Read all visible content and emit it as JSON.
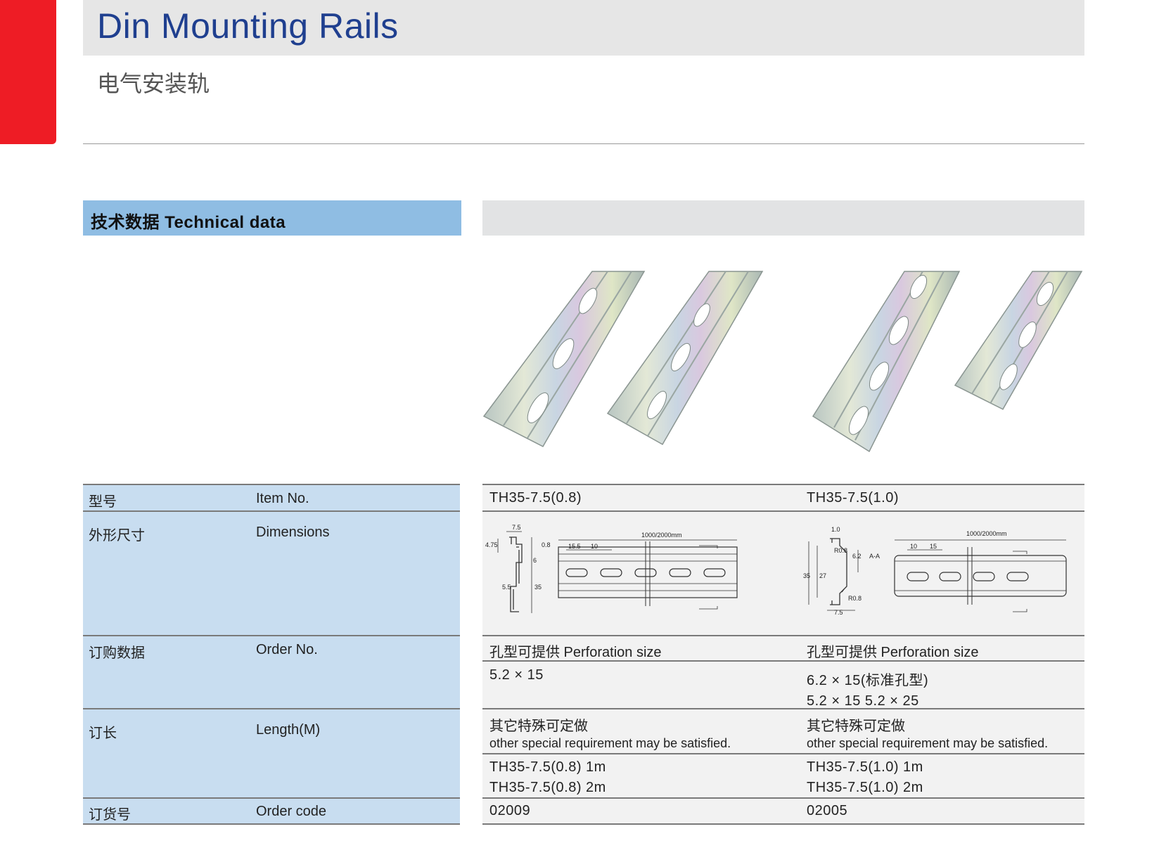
{
  "header": {
    "title": "Din Mounting Rails",
    "subtitle": "电气安装轨"
  },
  "section": {
    "title": "技术数据 Technical data"
  },
  "rows": [
    {
      "label_cn": "型号",
      "label_en": "Item No."
    },
    {
      "label_cn": "外形尺寸",
      "label_en": "Dimensions"
    },
    {
      "label_cn": "订购数据",
      "label_en": "Order No."
    },
    {
      "label_cn": "订长",
      "label_en": "Length(M)"
    },
    {
      "label_cn": "订货号",
      "label_en": "Order code"
    }
  ],
  "products": [
    {
      "item_no": "TH35-7.5(0.8)",
      "perforation_label": "孔型可提供  Perforation size",
      "perforation_line1": "5.2 × 15",
      "perforation_line2": "",
      "special_cn": "其它特殊可定做",
      "special_en": "other special requirement may be satisfied.",
      "length_line1": "TH35-7.5(0.8)  1m",
      "length_line2": "TH35-7.5(0.8)  2m",
      "order_code": "02009",
      "drawing": {
        "d_top": "7.5",
        "d_left": "4.75",
        "d_thick": "0.8",
        "d_6": "6",
        "d_55": "5.5",
        "d_35": "35",
        "d_155": "15.5",
        "d_10": "10",
        "d_len": "1000/2000mm"
      }
    },
    {
      "item_no": "TH35-7.5(1.0)",
      "perforation_label": "孔型可提供 Perforation size",
      "perforation_line1": "6.2 × 15(标准孔型)",
      "perforation_line2": "5.2 × 15    5.2 × 25",
      "special_cn": "其它特殊可定做",
      "special_en": "other special requirement may be satisfied.",
      "length_line1": "TH35-7.5(1.0)  1m",
      "length_line2": "TH35-7.5(1.0)  2m",
      "order_code": "02005",
      "drawing": {
        "d_top": "1.0",
        "d_r1": "R0.8",
        "d_r2": "R0.8",
        "d_62": "6.2",
        "d_aa": "A-A",
        "d_35": "35",
        "d_27": "27",
        "d_75": "7.5",
        "d_10": "10",
        "d_15": "15",
        "d_len": "1000/2000mm"
      }
    }
  ]
}
